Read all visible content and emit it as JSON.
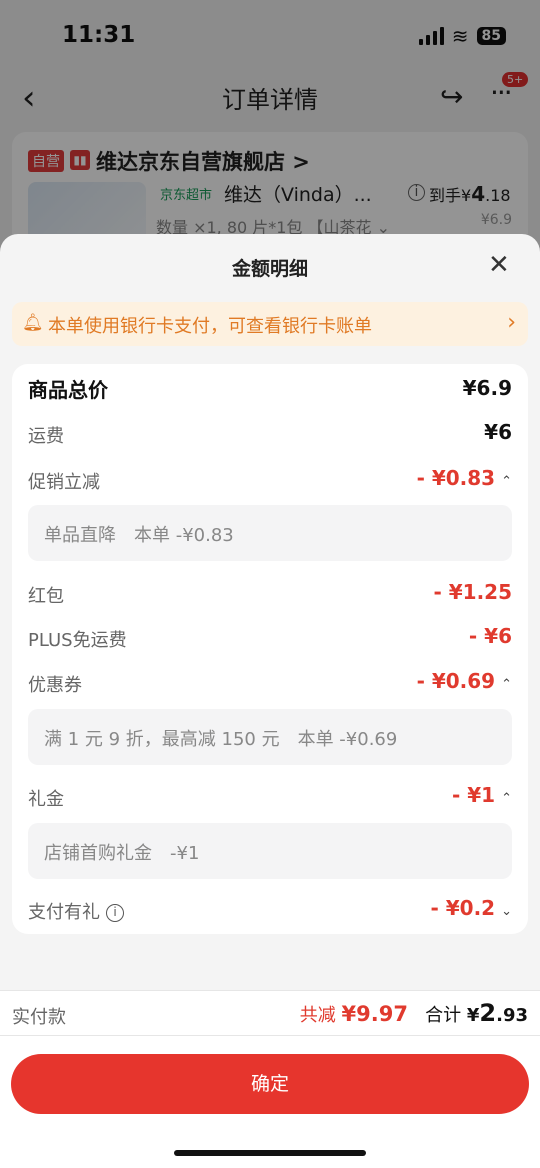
{
  "status": {
    "time": "11:31",
    "battery": "85"
  },
  "nav": {
    "title": "订单详情",
    "badge": "5+"
  },
  "order": {
    "self_tag": "自营",
    "store_name": "维达京东自营旗舰店 >",
    "supermarket_tag": "京东超市",
    "product_title": "维达（Vinda）...",
    "arrive_label": "到手",
    "arrive_currency": "¥",
    "arrive_int": "4",
    "arrive_dec": ".18",
    "spec": "数量 ×1, 80 片*1包 【山茶花 ⌄",
    "price": "¥6.9"
  },
  "sheet": {
    "title": "金额明细",
    "bank_notice": "本单使用银行卡支付，可查看银行卡账单",
    "rows": {
      "goods_total_label": "商品总价",
      "goods_total_value": "¥6.9",
      "shipping_label": "运费",
      "shipping_value": "¥6",
      "promo_label": "促销立减",
      "promo_value": "- ¥0.83",
      "promo_detail": "单品直降　本单 -¥0.83",
      "redpacket_label": "红包",
      "redpacket_value": "- ¥1.25",
      "plus_label": "PLUS免运费",
      "plus_value": "- ¥6",
      "coupon_label": "优惠券",
      "coupon_value": "- ¥0.69",
      "coupon_detail": "满 1 元 9 折，最高减 150 元　本单 -¥0.69",
      "gift_label": "礼金",
      "gift_value": "- ¥1",
      "gift_detail": "店铺首购礼金　-¥1",
      "paygift_label": "支付有礼",
      "paygift_value": "- ¥0.2"
    },
    "pay": {
      "label": "实付款",
      "saved_label": "共减",
      "saved_value": "¥9.97",
      "total_label": "合计",
      "total_currency": "¥",
      "total_int": "2",
      "total_dec": ".93"
    },
    "confirm_label": "确定"
  },
  "colors": {
    "accent": "#e6352d",
    "price_red": "#e03a2e",
    "notice_orange": "#e07a25",
    "notice_bg": "#fdf1e0"
  }
}
